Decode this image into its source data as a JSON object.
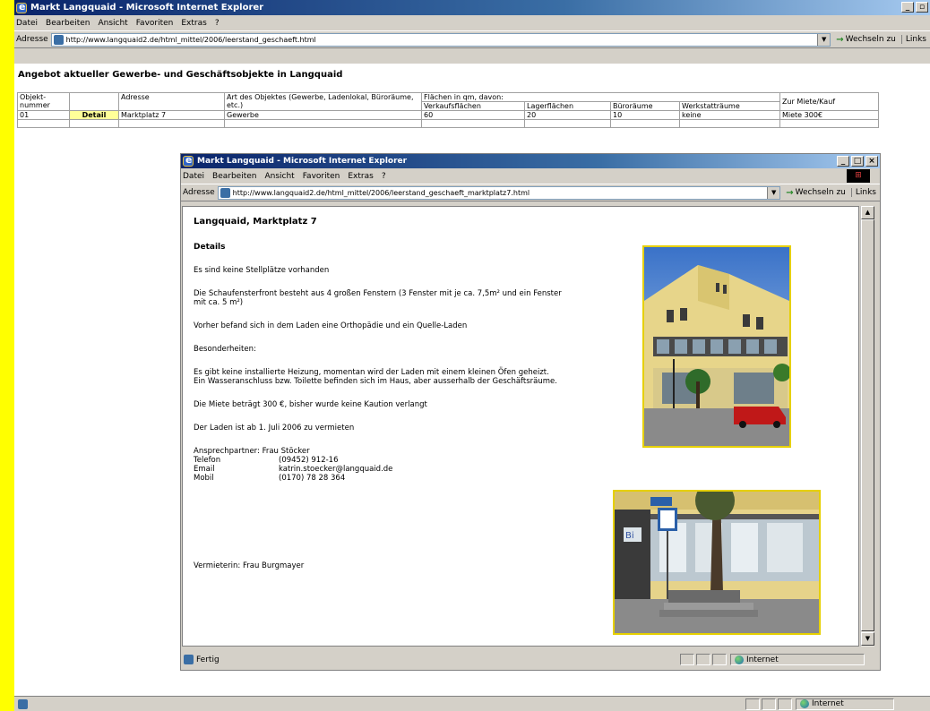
{
  "outer_window": {
    "title": "Markt Langquaid - Microsoft Internet Explorer",
    "menu": [
      "Datei",
      "Bearbeiten",
      "Ansicht",
      "Favoriten",
      "Extras",
      "?"
    ],
    "address_label": "Adresse",
    "url": "http://www.langquaid2.de/html_mittel/2006/leerstand_geschaeft.html",
    "go_label": "Wechseln zu",
    "links_label": "Links",
    "status_zone": "Internet"
  },
  "listing": {
    "title": "Angebot aktueller Gewerbe- und Geschäftsobjekte in Langquaid",
    "headers": {
      "objekt": "Objekt-\nnummer",
      "adresse": "Adresse",
      "art": "Art des Objektes (Gewerbe, Ladenlokal, Büroräume, etc.)",
      "flaechen": "Flächen in qm, davon:",
      "verkauf": "Verkaufsflächen",
      "lager": "Lagerflächen",
      "buero": "Büroräume",
      "werkstatt": "Werkstatträume",
      "miete": "Zur Miete/Kauf"
    },
    "row": {
      "nummer": "01",
      "detail": "Detail",
      "adresse": "Marktplatz 7",
      "art": "Gewerbe",
      "verkauf": "60",
      "lager": "20",
      "buero": "10",
      "werkstatt": "keine",
      "miete": "Miete 300€"
    }
  },
  "inner_window": {
    "title": "Markt Langquaid - Microsoft Internet Explorer",
    "menu": [
      "Datei",
      "Bearbeiten",
      "Ansicht",
      "Favoriten",
      "Extras",
      "?"
    ],
    "address_label": "Adresse",
    "url": "http://www.langquaid2.de/html_mittel/2006/leerstand_geschaeft_marktplatz7.html",
    "go_label": "Wechseln zu",
    "links_label": "Links",
    "status_text": "Fertig",
    "status_zone": "Internet"
  },
  "detail_page": {
    "heading": "Langquaid, Marktplatz 7",
    "subheading": "Details",
    "p1": "Es sind keine Stellplätze vorhanden",
    "p2a": "Die Schaufensterfront besteht aus 4 großen Fenstern (3 Fenster mit je ca. 7,5m² und ein Fenster",
    "p2b": "mit ca. 5 m²)",
    "p3": "Vorher befand sich in dem Laden eine Orthopädie und ein Quelle-Laden",
    "p4": "Besonderheiten:",
    "p5a": "Es gibt keine installierte Heizung, momentan wird der Laden mit einem kleinen Öfen geheizt.",
    "p5b": "Ein Wasseranschluss bzw. Toilette befinden sich im Haus, aber ausserhalb der Geschäftsräume.",
    "p6": "Die Miete beträgt 300 €, bisher wurde keine Kaution verlangt",
    "p7": "Der Laden ist ab 1. Juli 2006 zu vermieten",
    "contact_person": "Ansprechpartner: Frau Stöcker",
    "contacts": [
      {
        "label": "Telefon",
        "value": "(09452) 912-16"
      },
      {
        "label": "Email",
        "value": "katrin.stoecker@langquaid.de"
      },
      {
        "label": "Mobil",
        "value": "(0170) 78 28 364"
      }
    ],
    "landlord": "Vermieterin: Frau Burgmayer"
  }
}
